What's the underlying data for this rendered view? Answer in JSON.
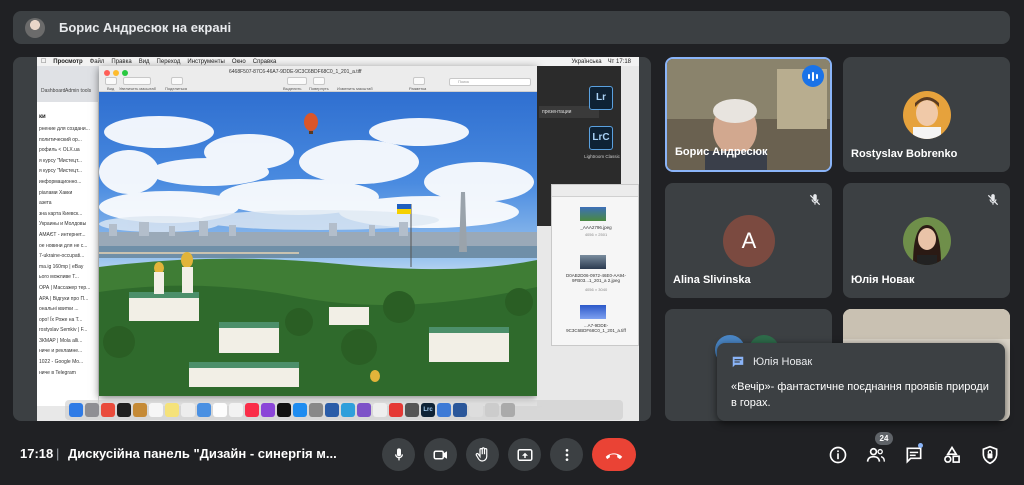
{
  "presenter_bar": {
    "title": "Борис Андресюк на екрані"
  },
  "shared_screen": {
    "menubar": {
      "items": [
        "Просмотр",
        "Файл",
        "Правка",
        "Вид",
        "Переход",
        "Инструменты",
        "Окно",
        "Справка"
      ],
      "right": [
        "Українська",
        "Чт 17:18"
      ]
    },
    "preview": {
      "filename": "6468F507-87C6-46A7-9DDE-9C3C6BDF68C0_1_201_a.tiff",
      "toolbar_labels": [
        "Вид",
        "Увеличить масштаб",
        "Поделиться",
        "Выделить",
        "Повернуть",
        "Изменить масштаб",
        "Разметка"
      ],
      "search_placeholder": "Поиск"
    },
    "browser_sidebar": {
      "heading": "ки",
      "lines": [
        "Dashboard",
        "Admin tools",
        "рнение для создани...",
        "политический ор...",
        "рофиль < OLX.ua",
        "я курсу \"Мистецт...",
        "я курсу \"Мистецт...",
        "информационно...",
        "ріалами Хакки",
        "азета",
        "зна карта Киевск...",
        "Украины и Молдовы",
        "АМАЄТ - интернет...",
        "ое новини для не с...",
        "7-ukraine-occupati...",
        "ma.ig 160mp | eBay",
        "ього можливе Т...",
        "ОРА | Массажер тер...",
        "АРА | Відгуки про П...",
        "ональні квитки ...",
        "оро! Їх Роже на Т...",
        "rostyslav Semkiv | F...",
        "ЗКМАР | Mola alli...",
        "ниче и рекламне...",
        "1022 - Google Mo...",
        "ниче в Telegram"
      ]
    },
    "right_panel": {
      "tab_label": "презентации",
      "lr_label": "Lr",
      "lrc_label": "LrC",
      "lrc_caption": "Lightroom Classic",
      "files": [
        {
          "name": "_AAA2796.jpeg",
          "sub": "4056 × 2501"
        },
        {
          "name": "D0AB2D06-0972-46E0-AA94-9FB03...1_201_a 2.jpeg",
          "sub": "4056 × 3040"
        },
        {
          "name": "...A7-9DDE-9C3C6BDF68C0_1_201_a.tiff",
          "sub": ""
        }
      ]
    },
    "dock_label": "Lrc"
  },
  "participants": [
    {
      "name": "Борис Андресюк",
      "type": "video",
      "speaking": true
    },
    {
      "name": "Rostyslav Bobrenko",
      "type": "photo",
      "muted": false
    },
    {
      "name": "Alina Slivinska",
      "type": "letter",
      "letter": "A",
      "muted": true
    },
    {
      "name": "Юлія Новак",
      "type": "photo",
      "muted": true
    }
  ],
  "chat_notification": {
    "sender": "Юлія Новак",
    "message": "«Вечір»- фантастичне поєднання проявів природи в горах."
  },
  "bottom_bar": {
    "time": "17:18",
    "separator": "|",
    "meeting_title": "Дискусійна панель \"Дизайн - синергія м...",
    "people_count": "24"
  },
  "colors": {
    "background": "#202124",
    "tile": "#3c4043",
    "accent_blue": "#1a73e8",
    "end_call_red": "#ea4335"
  },
  "icons": {
    "controls": [
      "mic-icon",
      "camera-icon",
      "raise-hand-icon",
      "present-icon",
      "more-options-icon",
      "end-call-icon"
    ],
    "right": [
      "info-icon",
      "people-icon",
      "chat-icon",
      "activities-icon",
      "host-controls-icon"
    ]
  }
}
